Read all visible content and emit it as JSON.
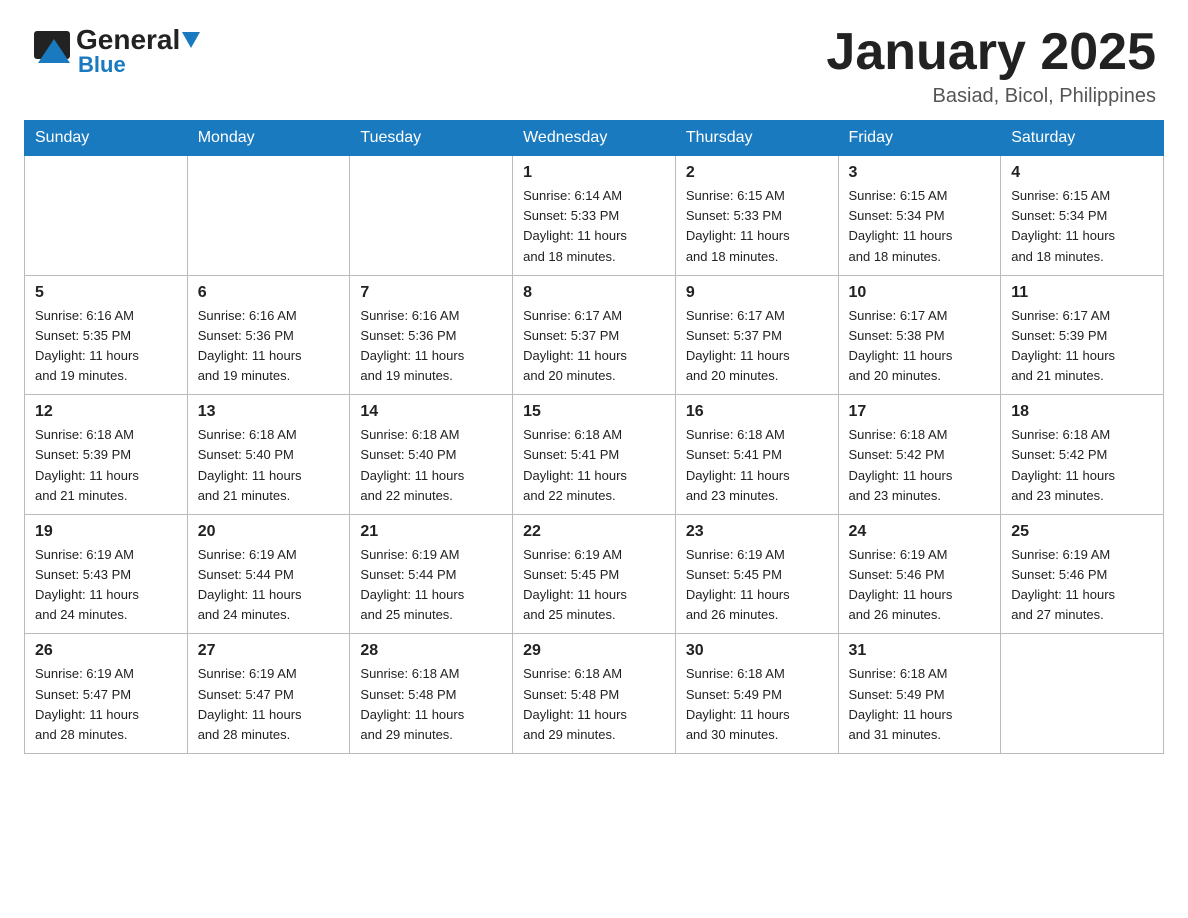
{
  "header": {
    "logo": {
      "general": "General",
      "blue": "Blue",
      "triangle_color": "#1a7abf"
    },
    "title": "January 2025",
    "subtitle": "Basiad, Bicol, Philippines"
  },
  "calendar": {
    "days_of_week": [
      "Sunday",
      "Monday",
      "Tuesday",
      "Wednesday",
      "Thursday",
      "Friday",
      "Saturday"
    ],
    "weeks": [
      [
        {
          "day": "",
          "info": ""
        },
        {
          "day": "",
          "info": ""
        },
        {
          "day": "",
          "info": ""
        },
        {
          "day": "1",
          "info": "Sunrise: 6:14 AM\nSunset: 5:33 PM\nDaylight: 11 hours\nand 18 minutes."
        },
        {
          "day": "2",
          "info": "Sunrise: 6:15 AM\nSunset: 5:33 PM\nDaylight: 11 hours\nand 18 minutes."
        },
        {
          "day": "3",
          "info": "Sunrise: 6:15 AM\nSunset: 5:34 PM\nDaylight: 11 hours\nand 18 minutes."
        },
        {
          "day": "4",
          "info": "Sunrise: 6:15 AM\nSunset: 5:34 PM\nDaylight: 11 hours\nand 18 minutes."
        }
      ],
      [
        {
          "day": "5",
          "info": "Sunrise: 6:16 AM\nSunset: 5:35 PM\nDaylight: 11 hours\nand 19 minutes."
        },
        {
          "day": "6",
          "info": "Sunrise: 6:16 AM\nSunset: 5:36 PM\nDaylight: 11 hours\nand 19 minutes."
        },
        {
          "day": "7",
          "info": "Sunrise: 6:16 AM\nSunset: 5:36 PM\nDaylight: 11 hours\nand 19 minutes."
        },
        {
          "day": "8",
          "info": "Sunrise: 6:17 AM\nSunset: 5:37 PM\nDaylight: 11 hours\nand 20 minutes."
        },
        {
          "day": "9",
          "info": "Sunrise: 6:17 AM\nSunset: 5:37 PM\nDaylight: 11 hours\nand 20 minutes."
        },
        {
          "day": "10",
          "info": "Sunrise: 6:17 AM\nSunset: 5:38 PM\nDaylight: 11 hours\nand 20 minutes."
        },
        {
          "day": "11",
          "info": "Sunrise: 6:17 AM\nSunset: 5:39 PM\nDaylight: 11 hours\nand 21 minutes."
        }
      ],
      [
        {
          "day": "12",
          "info": "Sunrise: 6:18 AM\nSunset: 5:39 PM\nDaylight: 11 hours\nand 21 minutes."
        },
        {
          "day": "13",
          "info": "Sunrise: 6:18 AM\nSunset: 5:40 PM\nDaylight: 11 hours\nand 21 minutes."
        },
        {
          "day": "14",
          "info": "Sunrise: 6:18 AM\nSunset: 5:40 PM\nDaylight: 11 hours\nand 22 minutes."
        },
        {
          "day": "15",
          "info": "Sunrise: 6:18 AM\nSunset: 5:41 PM\nDaylight: 11 hours\nand 22 minutes."
        },
        {
          "day": "16",
          "info": "Sunrise: 6:18 AM\nSunset: 5:41 PM\nDaylight: 11 hours\nand 23 minutes."
        },
        {
          "day": "17",
          "info": "Sunrise: 6:18 AM\nSunset: 5:42 PM\nDaylight: 11 hours\nand 23 minutes."
        },
        {
          "day": "18",
          "info": "Sunrise: 6:18 AM\nSunset: 5:42 PM\nDaylight: 11 hours\nand 23 minutes."
        }
      ],
      [
        {
          "day": "19",
          "info": "Sunrise: 6:19 AM\nSunset: 5:43 PM\nDaylight: 11 hours\nand 24 minutes."
        },
        {
          "day": "20",
          "info": "Sunrise: 6:19 AM\nSunset: 5:44 PM\nDaylight: 11 hours\nand 24 minutes."
        },
        {
          "day": "21",
          "info": "Sunrise: 6:19 AM\nSunset: 5:44 PM\nDaylight: 11 hours\nand 25 minutes."
        },
        {
          "day": "22",
          "info": "Sunrise: 6:19 AM\nSunset: 5:45 PM\nDaylight: 11 hours\nand 25 minutes."
        },
        {
          "day": "23",
          "info": "Sunrise: 6:19 AM\nSunset: 5:45 PM\nDaylight: 11 hours\nand 26 minutes."
        },
        {
          "day": "24",
          "info": "Sunrise: 6:19 AM\nSunset: 5:46 PM\nDaylight: 11 hours\nand 26 minutes."
        },
        {
          "day": "25",
          "info": "Sunrise: 6:19 AM\nSunset: 5:46 PM\nDaylight: 11 hours\nand 27 minutes."
        }
      ],
      [
        {
          "day": "26",
          "info": "Sunrise: 6:19 AM\nSunset: 5:47 PM\nDaylight: 11 hours\nand 28 minutes."
        },
        {
          "day": "27",
          "info": "Sunrise: 6:19 AM\nSunset: 5:47 PM\nDaylight: 11 hours\nand 28 minutes."
        },
        {
          "day": "28",
          "info": "Sunrise: 6:18 AM\nSunset: 5:48 PM\nDaylight: 11 hours\nand 29 minutes."
        },
        {
          "day": "29",
          "info": "Sunrise: 6:18 AM\nSunset: 5:48 PM\nDaylight: 11 hours\nand 29 minutes."
        },
        {
          "day": "30",
          "info": "Sunrise: 6:18 AM\nSunset: 5:49 PM\nDaylight: 11 hours\nand 30 minutes."
        },
        {
          "day": "31",
          "info": "Sunrise: 6:18 AM\nSunset: 5:49 PM\nDaylight: 11 hours\nand 31 minutes."
        },
        {
          "day": "",
          "info": ""
        }
      ]
    ]
  }
}
